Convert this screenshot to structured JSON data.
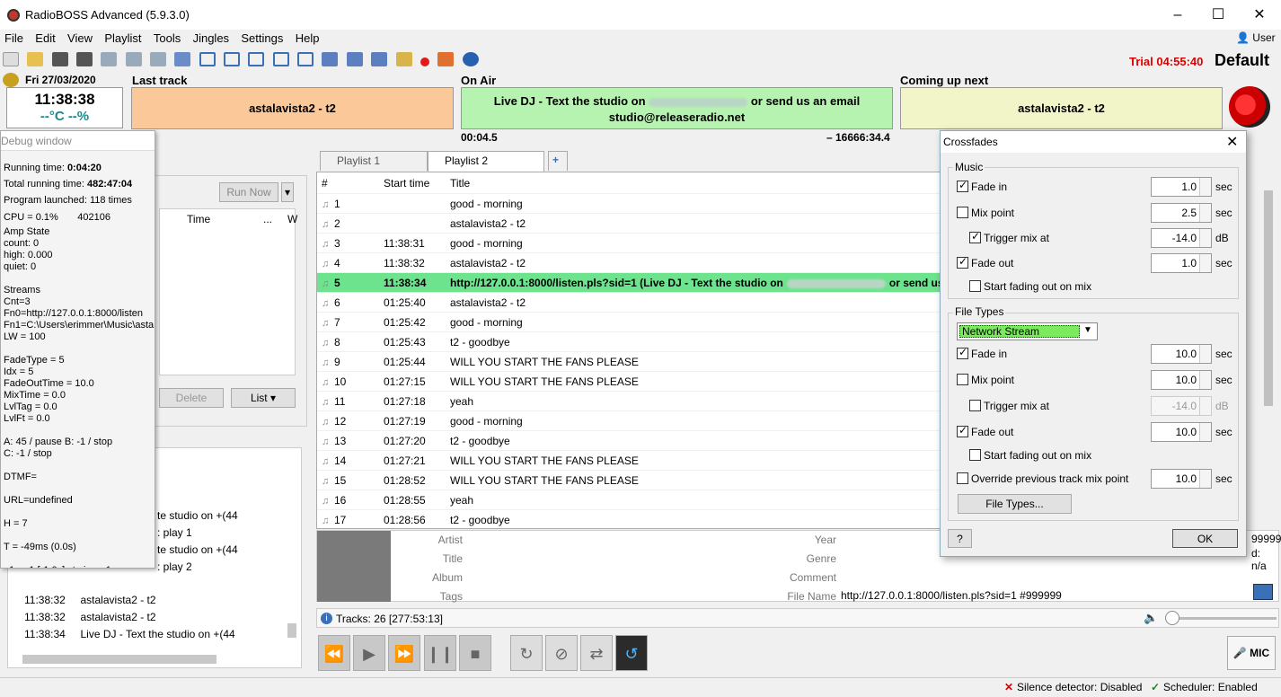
{
  "window": {
    "title": "RadioBOSS Advanced (5.9.3.0)",
    "user_label": "User"
  },
  "menu": [
    "File",
    "Edit",
    "View",
    "Playlist",
    "Tools",
    "Jingles",
    "Settings",
    "Help"
  ],
  "trial": {
    "label": "Trial 04:55:40",
    "profile": "Default"
  },
  "clock": {
    "date": "Fri 27/03/2020",
    "time": "11:38:38",
    "temp": "--°C --%"
  },
  "last_track": {
    "header": "Last track",
    "text": "astalavista2 - t2"
  },
  "on_air": {
    "header": "On Air",
    "line1": "Live DJ - Text the studio on",
    "line1b": "or send us an email",
    "line2": "studio@releaseradio.net",
    "elapsed": "00:04.5",
    "remaining": "– 16666:34.4"
  },
  "coming_up": {
    "header": "Coming up next",
    "text": "astalavista2 - t2"
  },
  "debug": {
    "title": "Debug window",
    "running_time_label": "Running time:",
    "running_time": "0:04:20",
    "total_running_label": "Total running time:",
    "total_running": "482:47:04",
    "program_launched": "Program launched:  118 times",
    "cpu": "CPU = 0.1%",
    "cpu_val": "402106",
    "lines": [
      "Amp State",
      "count: 0",
      "high: 0.000",
      "quiet: 0",
      "",
      "Streams",
      "Cnt=3",
      "Fn0=http://127.0.0.1:8000/listen",
      "Fn1=C:\\Users\\erimmer\\Music\\asta",
      "LW = 100",
      "",
      "FadeType = 5",
      "Idx = 5",
      "FadeOutTime = 10.0",
      "MixTime = 0.0",
      "LvlTag = 0.0",
      "LvlFt = 0.0",
      "",
      "A: 45 / pause  B: -1 / stop",
      "C: -1 / stop",
      "",
      "DTMF=",
      "",
      "URL=undefined",
      "",
      "H = 7",
      "",
      "T = -49ms (0.0s)",
      "",
      "e1 = -1 [-1.0s] stmin = -1"
    ]
  },
  "scheduler": {
    "run_now": "Run Now",
    "col_time": "Time",
    "col_more": "...",
    "col_w": "W",
    "delete": "Delete",
    "list": "List"
  },
  "log": [
    {
      "time": "",
      "text": "te studio on +(44"
    },
    {
      "time": "",
      "text": ": play 1"
    },
    {
      "time": "",
      "text": "te studio on +(44"
    },
    {
      "time": "",
      "text": ": play 2"
    },
    {
      "time": "11:38:32",
      "text": "astalavista2 - t2"
    },
    {
      "time": "11:38:32",
      "text": "astalavista2 - t2"
    },
    {
      "time": "11:38:34",
      "text": "Live DJ - Text the studio on +(44"
    }
  ],
  "playlist": {
    "tabs": [
      "Playlist 1",
      "Playlist 2"
    ],
    "columns": [
      "#",
      "Start time",
      "Title"
    ],
    "rows": [
      {
        "n": "1",
        "t": "",
        "title": "good - morning"
      },
      {
        "n": "2",
        "t": "",
        "title": "astalavista2 - t2"
      },
      {
        "n": "3",
        "t": "11:38:31",
        "title": "good - morning"
      },
      {
        "n": "4",
        "t": "11:38:32",
        "title": "astalavista2 - t2"
      },
      {
        "n": "5",
        "t": "11:38:34",
        "title": "http://127.0.0.1:8000/listen.pls?sid=1 (Live DJ - Text the studio on",
        "title_b": "or send us"
      },
      {
        "n": "6",
        "t": "01:25:40",
        "title": "astalavista2 - t2"
      },
      {
        "n": "7",
        "t": "01:25:42",
        "title": "good - morning"
      },
      {
        "n": "8",
        "t": "01:25:43",
        "title": "t2 - goodbye"
      },
      {
        "n": "9",
        "t": "01:25:44",
        "title": "WILL YOU START THE FANS PLEASE"
      },
      {
        "n": "10",
        "t": "01:27:15",
        "title": "WILL YOU START THE FANS PLEASE"
      },
      {
        "n": "11",
        "t": "01:27:18",
        "title": "yeah"
      },
      {
        "n": "12",
        "t": "01:27:19",
        "title": "good - morning"
      },
      {
        "n": "13",
        "t": "01:27:20",
        "title": "t2 - goodbye"
      },
      {
        "n": "14",
        "t": "01:27:21",
        "title": "WILL YOU START THE FANS PLEASE"
      },
      {
        "n": "15",
        "t": "01:28:52",
        "title": "WILL YOU START THE FANS PLEASE"
      },
      {
        "n": "16",
        "t": "01:28:55",
        "title": "yeah"
      },
      {
        "n": "17",
        "t": "01:28:56",
        "title": "t2 - goodbye"
      }
    ]
  },
  "info": {
    "artist": "Artist",
    "title": "Title",
    "album": "Album",
    "tags": "Tags",
    "year": "Year",
    "genre": "Genre",
    "comment": "Comment",
    "file_name": "File Name",
    "file_value": "http://127.0.0.1:8000/listen.pls?sid=1 #999999",
    "right1": "99999",
    "right2": "d: n/a"
  },
  "tracks": "Tracks: 26 [277:53:13]",
  "mic": "MIC",
  "status": {
    "silence": "Silence detector: Disabled",
    "scheduler": "Scheduler: Enabled"
  },
  "crossfades": {
    "title": "Crossfades",
    "music": {
      "label": "Music",
      "fade_in": "Fade in",
      "fade_in_val": "1.0",
      "mix_point": "Mix point",
      "mix_point_val": "2.5",
      "trigger": "Trigger mix at",
      "trigger_val": "-14.0",
      "fade_out": "Fade out",
      "fade_out_val": "1.0",
      "start_fading": "Start fading out on mix"
    },
    "filetypes": {
      "label": "File Types",
      "selected": "Network Stream",
      "fade_in": "Fade in",
      "fade_in_val": "10.0",
      "mix_point": "Mix point",
      "mix_point_val": "10.0",
      "trigger": "Trigger mix at",
      "trigger_val": "-14.0",
      "fade_out": "Fade out",
      "fade_out_val": "10.0",
      "start_fading": "Start fading out on mix",
      "override": "Override previous track mix point",
      "override_val": "10.0",
      "button": "File Types..."
    },
    "unit_sec": "sec",
    "unit_db": "dB",
    "help": "?",
    "ok": "OK"
  }
}
